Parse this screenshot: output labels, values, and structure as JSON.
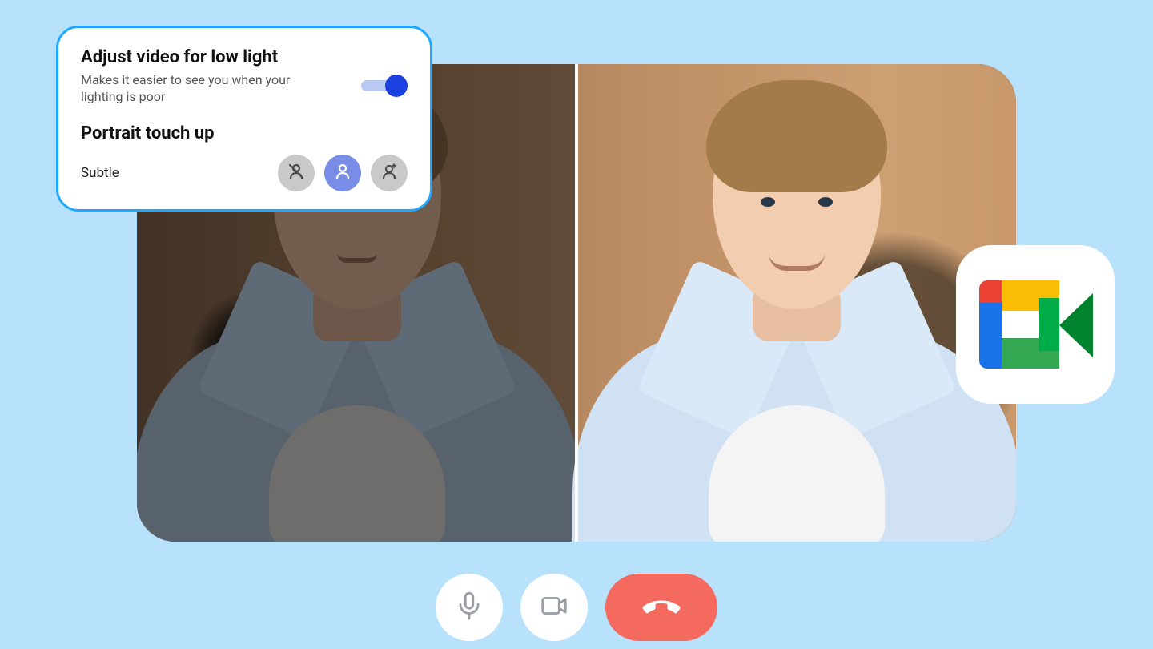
{
  "popover": {
    "lowlight_title": "Adjust video for low light",
    "lowlight_sub": "Makes it easier to see you when your lighting is poor",
    "lowlight_on": true,
    "touchup_title": "Portrait touch up",
    "touchup_level_label": "Subtle",
    "touchup_options": [
      "off",
      "subtle",
      "enhanced"
    ],
    "touchup_selected_index": 1
  },
  "controls": {
    "mic": "microphone",
    "camera": "camera",
    "end": "end-call"
  },
  "app": {
    "name": "Google Meet"
  }
}
